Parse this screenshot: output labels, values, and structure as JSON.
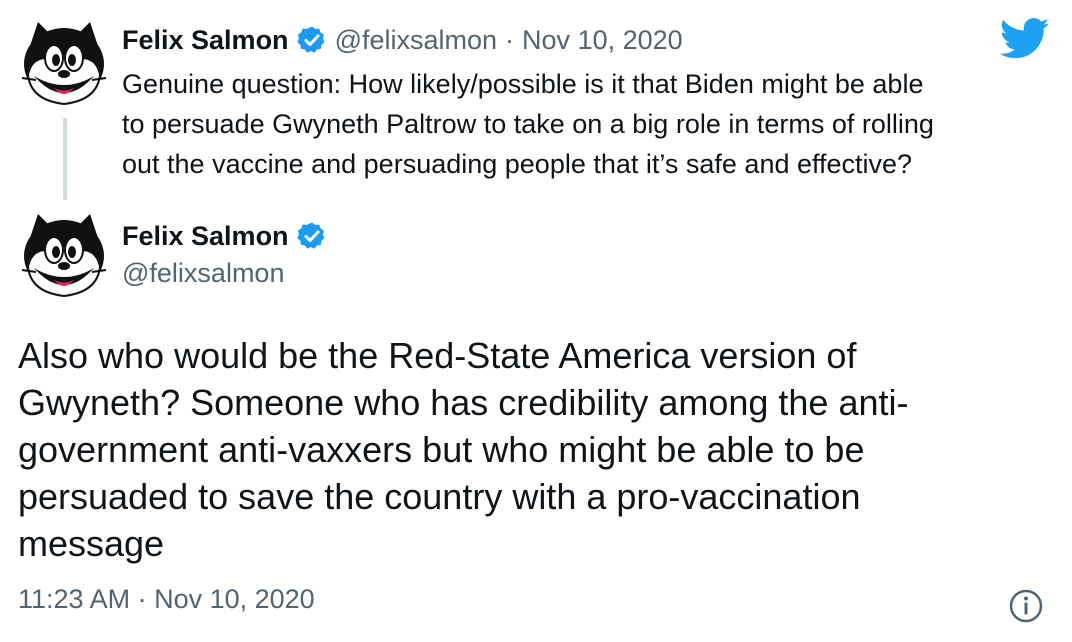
{
  "quoted_tweet": {
    "author_name": "Felix Salmon",
    "handle": "@felixsalmon",
    "separator": "·",
    "date": "Nov 10, 2020",
    "text_lines": [
      "Genuine question: How likely/possible is it that Biden might be able",
      "to persuade Gwyneth Paltrow to take on a big role in terms of rolling",
      "out the vaccine and persuading people that it’s safe and effective?"
    ]
  },
  "main_tweet": {
    "author_name": "Felix Salmon",
    "handle": "@felixsalmon",
    "text_lines": [
      "Also who would be the Red-State America version of",
      "Gwyneth? Someone who has credibility among the anti-",
      "government anti-vaxxers but who might be able to be",
      "persuaded to save the country with a pro-vaccination",
      "message"
    ],
    "timestamp": "11:23 AM · Nov 10, 2020"
  },
  "colors": {
    "verified_blue": "#1d9bf0",
    "twitter_blue": "#1da1f2",
    "muted_text": "#536471",
    "thread_line": "#cfd9de"
  },
  "icons": {
    "verified": "verified-badge-icon",
    "brand": "twitter-bird-icon",
    "info": "info-icon"
  }
}
